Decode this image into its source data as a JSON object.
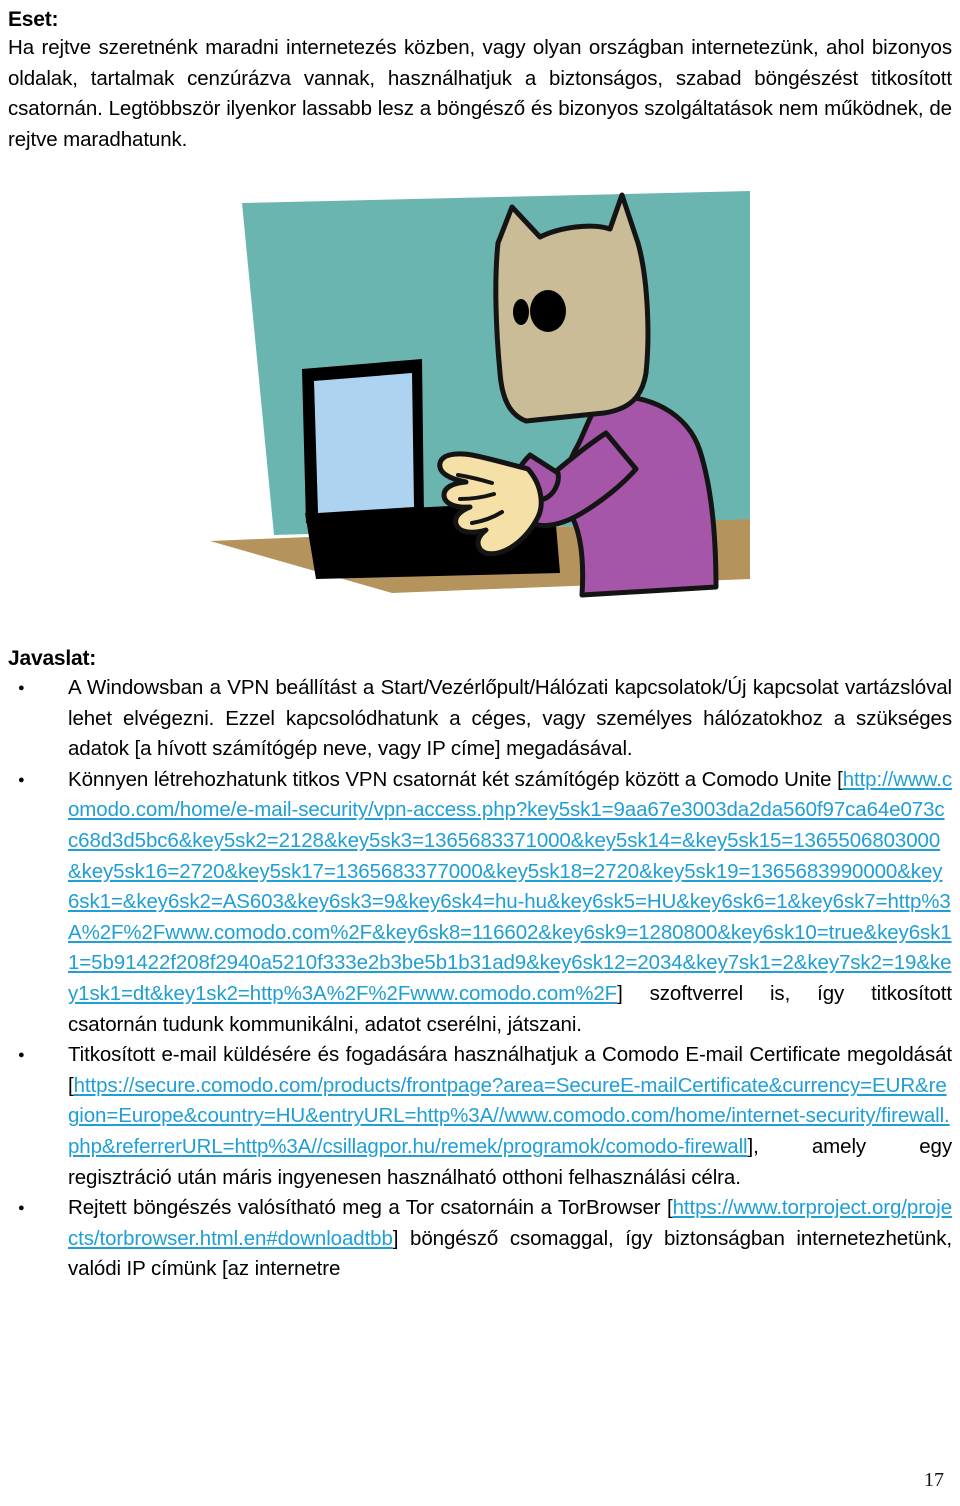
{
  "document": {
    "page_number": "17",
    "language": "hu"
  },
  "section_case": {
    "heading": "Eset:",
    "body": "Ha rejtve szeretnénk maradni internetezés közben, vagy olyan országban internetezünk, ahol bizonyos oldalak, tartalmak cenzúrázva vannak, használhatjuk a biztonságos, szabad böngészést titkosított csatornán. Legtöbbször ilyenkor lassabb lesz a böngésző és bizonyos szolgáltatások nem működnek, de rejtve maradhatunk."
  },
  "illustration": {
    "name": "anonymous-user-with-paper-bag-at-laptop",
    "colors": {
      "background_teal": "#6BB5B0",
      "paper_bag": "#C9BC96",
      "shirt_purple": "#A556A8",
      "skin_cream": "#F5E0A8",
      "desk_brown": "#B4935C",
      "laptop_black": "#000000",
      "screen_blue": "#ADD3F0",
      "outline": "#141414"
    }
  },
  "section_recommendation": {
    "heading": "Javaslat:",
    "bullets": [
      {
        "id": "vpn-windows",
        "text": "A Windowsban a VPN beállítást a Start/Vezérlőpult/Hálózati kapcsolatok/Új kapcsolat vartázslóval lehet elvégezni. Ezzel kapcsolódhatunk a céges, vagy személyes hálózatokhoz a szükséges adatok [a hívott számítógép neve, vagy IP címe] megadásával."
      },
      {
        "id": "comodo-unite",
        "lead": "Könnyen létrehozhatunk titkos VPN csatornát két számítógép között a Comodo Unite",
        "bracket_open": "[",
        "url": "http://www.comodo.com/home/e-mail-security/vpn-access.php?key5sk1=9aa67e3003da2da560f97ca64e073cc68d3d5bc6&key5sk2=2128&key5sk3=1365683371000&key5sk14=&key5sk15=1365506803000&key5sk16=2720&key5sk17=1365683377000&key5sk18=2720&key5sk19=1365683990000&key6sk1=&key6sk2=AS603&key6sk3=9&key6sk4=hu-hu&key6sk5=HU&key6sk6=1&key6sk7=http%3A%2F%2Fwww.comodo.com%2F&key6sk8=116602&key6sk9=1280800&key6sk10=true&key6sk11=5b91422f208f2940a5210f333e2b3be5b1b31ad9&key6sk12=2034&key7sk1=2&key7sk2=19&key1sk1=dt&key1sk2=http%3A%2F%2Fwww.comodo.com%2F",
        "bracket_close": "]",
        "tail": " szoftverrel is, így titkosított csatornán tudunk kommunikálni, adatot cserélni, játszani."
      },
      {
        "id": "comodo-email-certificate",
        "lead": "Titkosított e-mail küldésére és fogadására használhatjuk a Comodo E-mail Certificate megoldását",
        "bracket_open": "[",
        "url": "https://secure.comodo.com/products/frontpage?area=SecureE-mailCertificate&currency=EUR&region=Europe&country=HU&entryURL=http%3A//www.comodo.com/home/internet-security/firewall.php&referrerURL=http%3A//csillagpor.hu/remek/programok/comodo-firewall",
        "bracket_close": "]",
        "tail": ", amely egy regisztráció után máris ingyenesen használható otthoni felhasználási célra."
      },
      {
        "id": "tor-browser",
        "lead": "Rejtett böngészés valósítható meg a Tor csatornáin a TorBrowser",
        "bracket_open": "[",
        "url": "https://www.torproject.org/projects/torbrowser.html.en#downloadtbb",
        "bracket_close": "]",
        "tail": " böngésző csomaggal, így biztonságban internetezhetünk, valódi IP címünk [az internetre"
      }
    ]
  }
}
